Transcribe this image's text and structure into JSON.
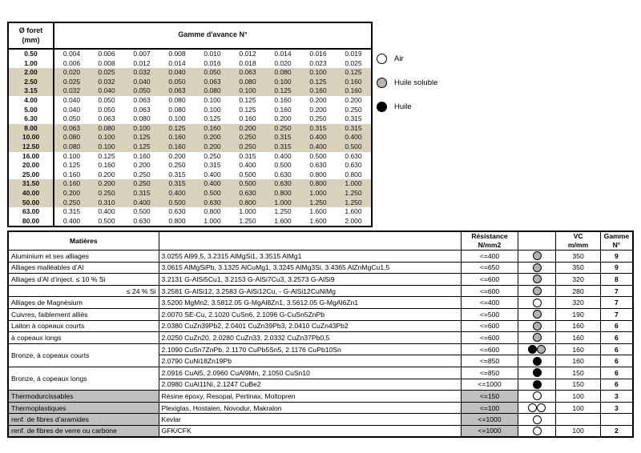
{
  "feed_table": {
    "diameter_header": "Ø foret\n(mm)",
    "diameter_header_line1": "Ø foret",
    "diameter_header_line2": "(mm)",
    "gamme_header": "Gamme d'avance N°",
    "diameters": [
      "0.50",
      "1.00",
      "2.00",
      "2.50",
      "3.15",
      "4.00",
      "5.00",
      "6.30",
      "8.00",
      "10.00",
      "12.50",
      "16.00",
      "20.00",
      "25.00",
      "31.50",
      "40.00",
      "50.00",
      "63.00",
      "80.00"
    ],
    "shaded": [
      false,
      false,
      true,
      true,
      true,
      false,
      false,
      false,
      true,
      true,
      true,
      false,
      false,
      false,
      true,
      true,
      true,
      false,
      false
    ],
    "rows": [
      [
        "0.004",
        "0.006",
        "0.007",
        "0.008",
        "0.010",
        "0.012",
        "0.014",
        "0.016",
        "0.019"
      ],
      [
        "0.006",
        "0.008",
        "0.012",
        "0.014",
        "0.016",
        "0.018",
        "0.020",
        "0.023",
        "0.025"
      ],
      [
        "0.020",
        "0.025",
        "0.032",
        "0.040",
        "0.050",
        "0.063",
        "0.080",
        "0.100",
        "0.125"
      ],
      [
        "0.025",
        "0.032",
        "0.040",
        "0.050",
        "0.063",
        "0.080",
        "0.100",
        "0.125",
        "0.160"
      ],
      [
        "0.032",
        "0.040",
        "0.050",
        "0.063",
        "0.080",
        "0.100",
        "0.125",
        "0.160",
        "0.160"
      ],
      [
        "0.040",
        "0.050",
        "0.063",
        "0.080",
        "0.100",
        "0.125",
        "0.160",
        "0.200",
        "0.200"
      ],
      [
        "0.040",
        "0.050",
        "0.063",
        "0.080",
        "0.100",
        "0.125",
        "0.160",
        "0.200",
        "0.250"
      ],
      [
        "0.050",
        "0.063",
        "0.080",
        "0.100",
        "0.125",
        "0.160",
        "0.200",
        "0.250",
        "0.315"
      ],
      [
        "0.063",
        "0.080",
        "0.100",
        "0.125",
        "0.160",
        "0.200",
        "0.250",
        "0.315",
        "0.315"
      ],
      [
        "0.080",
        "0.100",
        "0.125",
        "0.160",
        "0.200",
        "0.250",
        "0.315",
        "0.400",
        "0.400"
      ],
      [
        "0.080",
        "0.100",
        "0.125",
        "0.160",
        "0.200",
        "0.250",
        "0.315",
        "0.400",
        "0.500"
      ],
      [
        "0.100",
        "0.125",
        "0.160",
        "0.200",
        "0.250",
        "0.315",
        "0.400",
        "0.500",
        "0.630"
      ],
      [
        "0.125",
        "0.160",
        "0.200",
        "0.250",
        "0.315",
        "0.400",
        "0.500",
        "0.630",
        "0.630"
      ],
      [
        "0.160",
        "0.200",
        "0.250",
        "0.315",
        "0.400",
        "0.500",
        "0.630",
        "0.800",
        "0.800"
      ],
      [
        "0.160",
        "0.200",
        "0.250",
        "0.315",
        "0.400",
        "0.500",
        "0.630",
        "0.800",
        "1.000"
      ],
      [
        "0.200",
        "0.250",
        "0.315",
        "0.400",
        "0.500",
        "0.630",
        "0.800",
        "1.000",
        "1.250"
      ],
      [
        "0.250",
        "0.310",
        "0.400",
        "0.500",
        "0.630",
        "0.800",
        "1.000",
        "1.250",
        "1.250"
      ],
      [
        "0.315",
        "0.400",
        "0.500",
        "0.630",
        "0.800",
        "1.000",
        "1.250",
        "1.600",
        "1.600"
      ],
      [
        "0.400",
        "0.500",
        "0.630",
        "0.800",
        "1.000",
        "1.250",
        "1.600",
        "1.600",
        "2.000"
      ]
    ]
  },
  "legend": {
    "items": [
      {
        "label": "Air",
        "style": "air"
      },
      {
        "label": "Huile soluble",
        "style": "soluble"
      },
      {
        "label": "Huile",
        "style": "huile"
      }
    ]
  },
  "materials_table": {
    "headers": {
      "matieres": "Matières",
      "resistance_line1": "Résistance",
      "resistance_line2": "N/mm2",
      "vc_line1": "VC",
      "vc_line2": "m/mm",
      "gamme_line1": "Gamme",
      "gamme_line2": "N°"
    },
    "rows": [
      {
        "name": "Aluminium et ses alliages",
        "name_fill": "green",
        "name_align": "left",
        "rowspan": 1,
        "desc": [
          "3.0255 Al99,5, 3.2315 AlMgSi1, 3.3515 AlMg1"
        ],
        "resistance": "<=400",
        "res_fill": "green",
        "circles": [
          "soluble"
        ],
        "vc": "350",
        "gamme": "9"
      },
      {
        "name": "Alliages malléables d’Al",
        "name_fill": "green",
        "name_align": "left",
        "rowspan": 1,
        "desc": [
          "3.0615 AlMgSiPb, 3.1325 AlCuMg1, 3.3245 AlMg3Si, 3.4365 AlZnMgCu1,5"
        ],
        "resistance": "<=650",
        "res_fill": "green",
        "circles": [
          "soluble"
        ],
        "vc": "350",
        "gamme": "9"
      },
      {
        "name": "Alliages d’Al d’inject. ≤ 10 % Si",
        "name_fill": "green",
        "name_align": "left",
        "rowspan": 1,
        "desc": [
          "3.2131 G-AlSi5Cu1, 3.2153 G-AlSi7Cu3, 3.2573 G-AlSi9"
        ],
        "resistance": "<=600",
        "res_fill": "green",
        "circles": [
          "soluble"
        ],
        "vc": "320",
        "gamme": "8"
      },
      {
        "name": "≤ 24 % Si",
        "name_fill": "green",
        "name_align": "right",
        "rowspan": 1,
        "desc": [
          "3.2581 G-AlSi12, 3.2583 G-AlSi12Cu, - G-AlSi12CuNiMg"
        ],
        "resistance": "<=600",
        "res_fill": "green",
        "circles": [
          "soluble"
        ],
        "vc": "280",
        "gamme": "7"
      },
      {
        "name": "Alliages de Magnésium",
        "name_fill": "green",
        "name_align": "left",
        "rowspan": 1,
        "desc": [
          "3.5200 MgMn2, 3.5812.05 G-MgAl8Zn1, 3.5612.05 G-MgAl6Zn1"
        ],
        "resistance": "<=400",
        "res_fill": "green",
        "circles": [
          "air"
        ],
        "vc": "320",
        "gamme": "7"
      },
      {
        "name": "Cuivres, faiblement alliés",
        "name_fill": "green",
        "name_align": "left",
        "rowspan": 1,
        "desc": [
          "2.0070 SE-Cu, 2.1020 CuSn6, 2.1096 G-CuSn5ZnPb"
        ],
        "resistance": "<=500",
        "res_fill": "green",
        "circles": [
          "soluble"
        ],
        "vc": "190",
        "gamme": "7"
      },
      {
        "name": "Laiton à copeaux courts",
        "name_fill": "green",
        "name_align": "left",
        "rowspan": 1,
        "desc": [
          "2.0380 CuZn39Pb2, 2.0401 CuZn39Pb3, 2.0410 CuZn43Pb2"
        ],
        "resistance": "<=600",
        "res_fill": "green",
        "circles": [
          "soluble"
        ],
        "vc": "160",
        "gamme": "6"
      },
      {
        "name": "à copeaux longs",
        "name_fill": "green",
        "name_align": "left",
        "rowspan": 1,
        "desc": [
          "2.0250 CuZn20, 2.0280 CuZn33, 2.0332 CuZn37Pb0,5"
        ],
        "resistance": "<=600",
        "res_fill": "green",
        "circles": [
          "soluble"
        ],
        "vc": "160",
        "gamme": "6"
      },
      {
        "name": "Bronze, à copeaux courts",
        "name_fill": "green",
        "name_align": "left",
        "rowspan": 2,
        "desc": [
          "2.1090 CuSn7ZnPb, 2.1170 CuPb5Sn5, 2.1176 CuPb10Sn",
          "2.0790 CuNi18Zn19Pb"
        ],
        "resistance": "<=600",
        "res_fill": "green",
        "circles": [
          "huile",
          "soluble"
        ],
        "vc": "160",
        "gamme": "6",
        "resistance2": "<=850",
        "res_fill2": "green",
        "circles2": [
          "huile"
        ],
        "vc2": "160",
        "gamme2": "6"
      },
      {
        "name": "Bronze, à copeaux longs",
        "name_fill": "green",
        "name_align": "left",
        "rowspan": 2,
        "desc": [
          "2.0916 CuAl5, 2.0960 CuAl9Mn, 2.1050 CuSn10",
          "2.0980 CuAl11Ni, 2.1247 CuBe2"
        ],
        "resistance": "<=850",
        "res_fill": "green",
        "circles": [
          "huile"
        ],
        "vc": "150",
        "gamme": "6",
        "resistance2": "<=1000",
        "res_fill2": "green",
        "circles2": [
          "huile"
        ],
        "vc2": "150",
        "gamme2": "6"
      },
      {
        "name": "Thermodurcissables",
        "name_fill": "gray",
        "name_align": "left",
        "rowspan": 1,
        "desc": [
          "Résine époxy, Resopal, Pertinax, Moltopren"
        ],
        "resistance": "<=150",
        "res_fill": "gray",
        "circles": [
          "air"
        ],
        "vc": "100",
        "gamme": "3"
      },
      {
        "name": "Thermoplastiques",
        "name_fill": "gray",
        "name_align": "left",
        "rowspan": 1,
        "desc": [
          "Plexiglas, Hostalen, Novodur, Makralon"
        ],
        "resistance": "<=100",
        "res_fill": "gray",
        "circles": [
          "air",
          "air"
        ],
        "vc": "100",
        "gamme": "3"
      },
      {
        "name": "renf. de fibres d’aramides",
        "name_fill": "gray",
        "name_align": "left",
        "rowspan": 1,
        "desc": [
          "Kevlar"
        ],
        "resistance": "<=1000",
        "res_fill": "gray",
        "circles": [
          "air"
        ],
        "vc": "",
        "gamme": ""
      },
      {
        "name": "renf. de fibres de verre ou carbone",
        "name_fill": "gray",
        "name_align": "left",
        "rowspan": 1,
        "desc": [
          "GFK/CFK"
        ],
        "resistance": "<=1000",
        "res_fill": "gray",
        "circles": [
          "air"
        ],
        "vc": "100",
        "gamme": "2"
      }
    ]
  },
  "colors": {
    "green": "#00b050",
    "gray": "#bfbfbf",
    "band_beige": "#d8d1bc",
    "soluble": "#b3b3b3",
    "huile": "#000000",
    "air": "#ffffff"
  }
}
